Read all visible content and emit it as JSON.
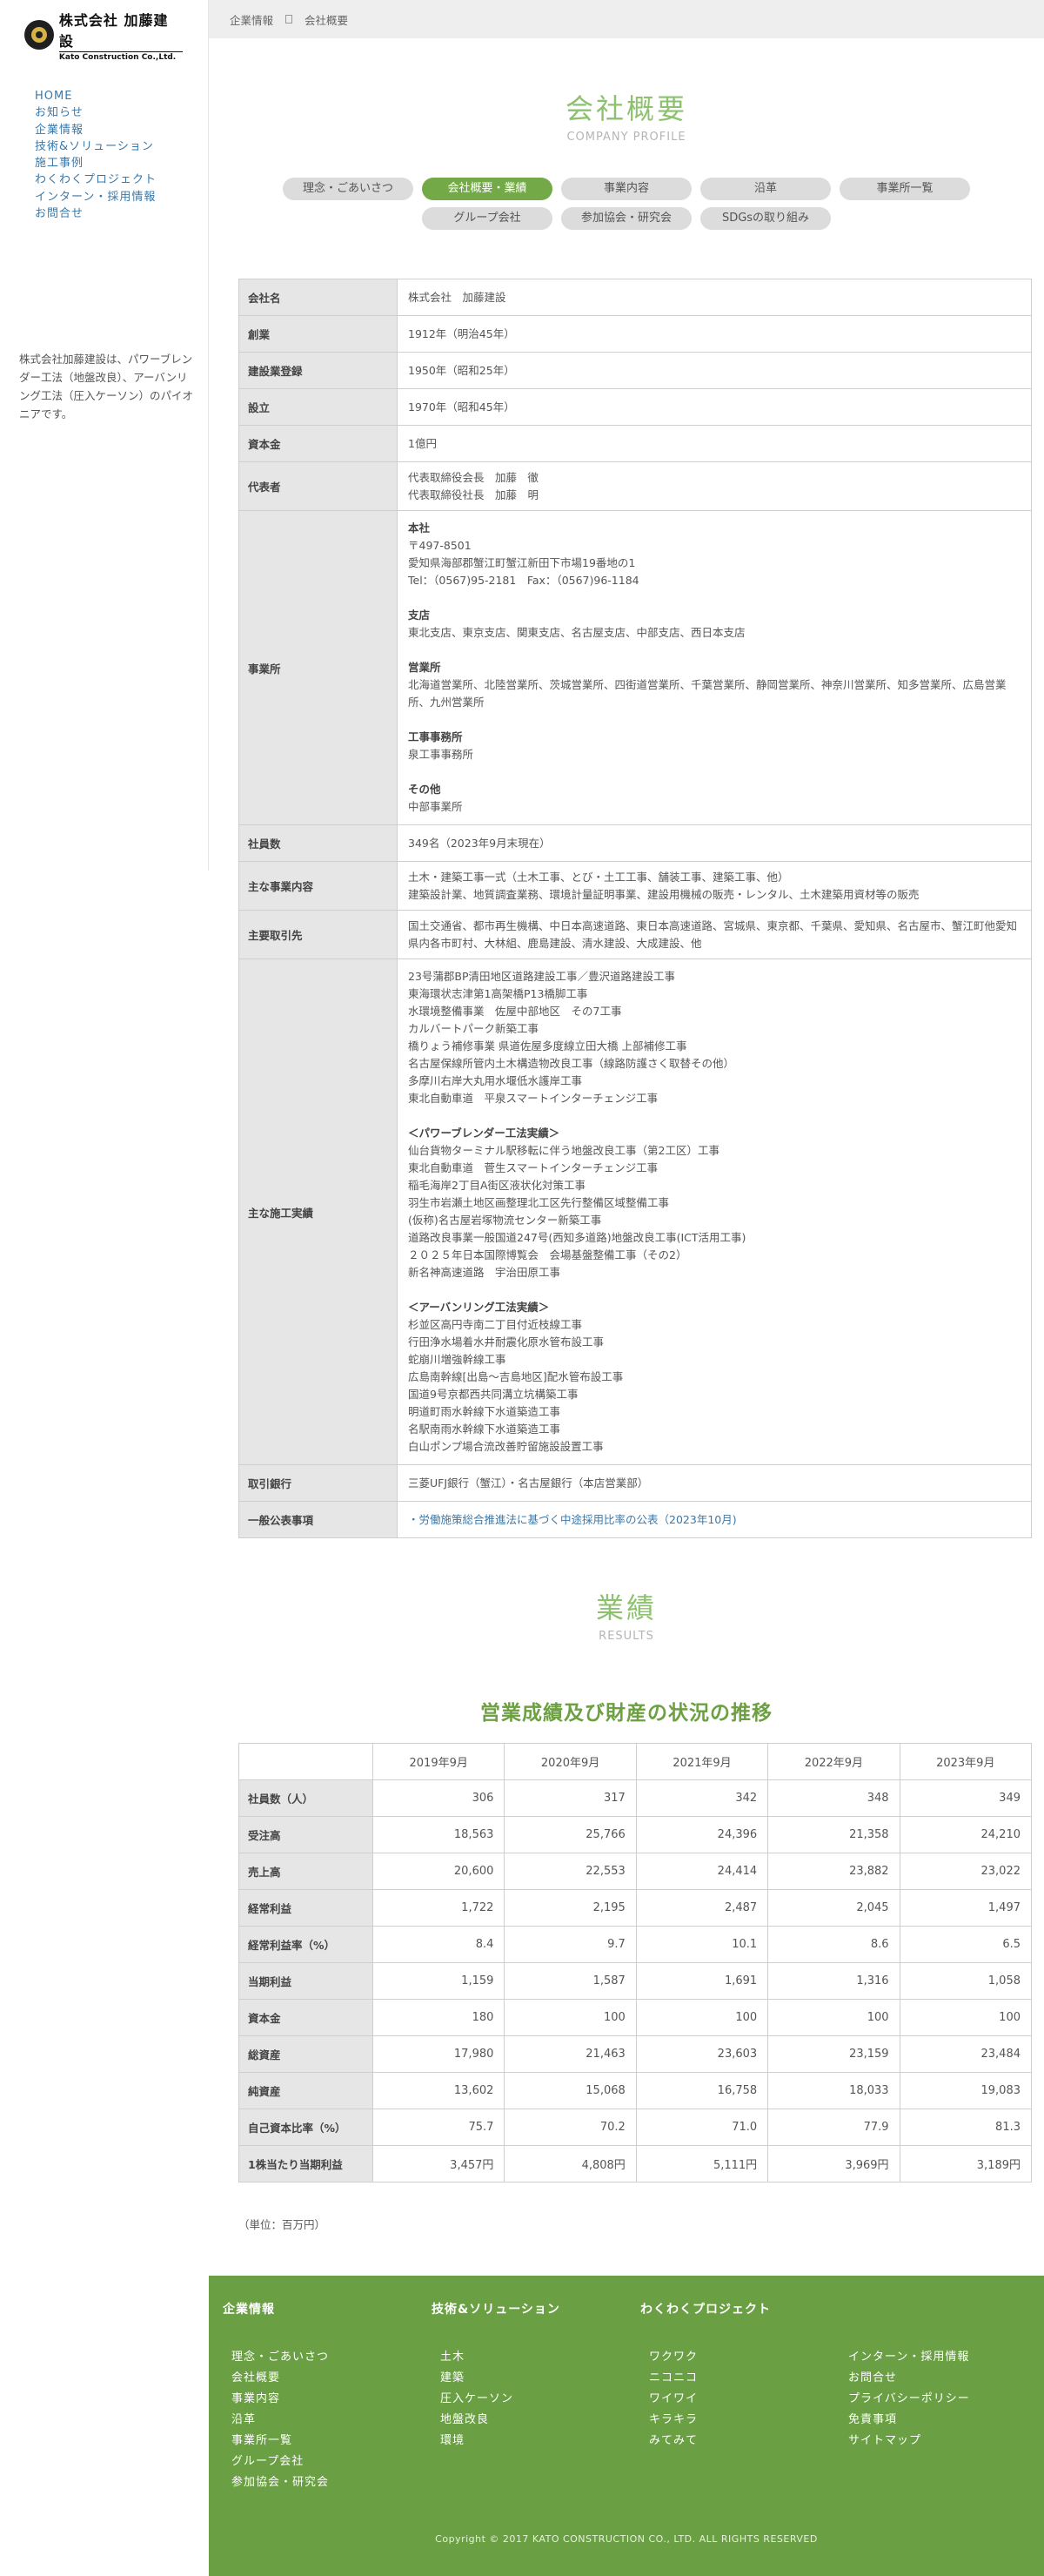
{
  "logo": {
    "name_jp": "株式会社 加藤建設",
    "name_en": "Kato Construction Co.,Ltd."
  },
  "side_nav": [
    "HOME",
    "お知らせ",
    "企業情報",
    "技術&ソリューション",
    "施工事例",
    "わくわくプロジェクト",
    "インターン・採用情報",
    "お問合せ"
  ],
  "side_description": "株式会社加藤建設は、パワーブレンダー工法（地盤改良）、アーバンリング工法（圧入ケーソン）のパイオニアです。",
  "breadcrumb": [
    "企業情報",
    "会社概要"
  ],
  "profile_heading": {
    "jp": "会社概要",
    "en": "COMPANY PROFILE"
  },
  "tabs": [
    "理念・ごあいさつ",
    "会社概要・業績",
    "事業内容",
    "沿革",
    "事業所一覧",
    "グループ会社",
    "参加協会・研究会",
    "SDGsの取り組み"
  ],
  "active_tab": "会社概要・業績",
  "profile": {
    "company_name": {
      "label": "会社名",
      "value": "株式会社　加藤建設"
    },
    "founded": {
      "label": "創業",
      "value": "1912年（明治45年）"
    },
    "registration": {
      "label": "建設業登録",
      "value": "1950年（昭和25年）"
    },
    "established": {
      "label": "設立",
      "value": "1970年（昭和45年）"
    },
    "capital": {
      "label": "資本金",
      "value": "1億円"
    },
    "representative": {
      "label": "代表者",
      "lines": [
        "代表取締役会長　加藤　徹",
        "代表取締役社長　加藤　明"
      ]
    },
    "offices": {
      "label": "事業所",
      "head_title": "本社",
      "head_lines": [
        "〒497-8501",
        "愛知県海部郡蟹江町蟹江新田下市場19番地の1",
        "Tel：（0567)95-2181　Fax：（0567)96-1184"
      ],
      "branch_title": "支店",
      "branch_line": "東北支店、東京支店、関東支店、名古屋支店、中部支店、西日本支店",
      "sales_title": "営業所",
      "sales_line": "北海道営業所、北陸営業所、茨城営業所、四街道営業所、千葉営業所、静岡営業所、神奈川営業所、知多営業所、広島営業所、九州営業所",
      "works_title": "工事事務所",
      "works_line": "泉工事事務所",
      "other_title": "その他",
      "other_line": "中部事業所"
    },
    "employees": {
      "label": "社員数",
      "value": "349名（2023年9月末現在）"
    },
    "business": {
      "label": "主な事業内容",
      "lines": [
        "土木・建築工事一式（土木工事、とび・土工工事、舗装工事、建築工事、他）",
        "建築設計業、地質調査業務、環境計量証明事業、建設用機械の販売・レンタル、土木建築用資材等の販売"
      ]
    },
    "clients": {
      "label": "主要取引先",
      "value": "国土交通省、都市再生機構、中日本高速道路、東日本高速道路、宮城県、東京都、千葉県、愛知県、名古屋市、蟹江町他愛知県内各市町村、大林組、鹿島建設、清水建設、大成建設、他"
    },
    "works": {
      "label": "主な施工実績",
      "group1": [
        "23号蒲郡BP清田地区道路建設工事／豊沢道路建設工事",
        "東海環状志津第1高架橋P13橋脚工事",
        "水環境整備事業　佐屋中部地区　その7工事",
        "カルバートパーク新築工事",
        "橋りょう補修事業 県道佐屋多度線立田大橋 上部補修工事",
        "名古屋保線所管内土木構造物改良工事（線路防護さく取替その他）",
        "多摩川右岸大丸用水堰低水護岸工事",
        "東北自動車道　平泉スマートインターチェンジ工事"
      ],
      "pb_title": "＜パワーブレンダー工法実績＞",
      "group2": [
        "仙台貨物ターミナル駅移転に伴う地盤改良工事（第2工区）工事",
        "東北自動車道　菅生スマートインターチェンジ工事",
        "稲毛海岸2丁目A街区液状化対策工事",
        "羽生市岩瀬土地区画整理北工区先行整備区域整備工事",
        "(仮称)名古屋岩塚物流センター新築工事",
        "道路改良事業一般国道247号(西知多道路)地盤改良工事(ICT活用工事)",
        "２０２５年日本国際博覧会　会場基盤整備工事（その2）",
        "新名神高速道路　宇治田原工事"
      ],
      "ur_title": "＜アーバンリング工法実績＞",
      "group3": [
        "杉並区高円寺南二丁目付近枝線工事",
        "行田浄水場着水井耐震化原水管布設工事",
        "蛇崩川増強幹線工事",
        "広島南幹線[出島〜吉島地区]配水管布設工事",
        "国道9号京都西共同溝立坑構築工事",
        "明道町雨水幹線下水道築造工事",
        "名駅南雨水幹線下水道築造工事",
        "白山ポンプ場合流改善貯留施設設置工事"
      ]
    },
    "bank": {
      "label": "取引銀行",
      "value": "三菱UFJ銀行（蟹江）・名古屋銀行（本店営業部）"
    },
    "public_notice": {
      "label": "一般公表事項",
      "value": "・労働施策総合推進法に基づく中途採用比率の公表（2023年10月)"
    }
  },
  "results_heading": {
    "jp": "業績",
    "en": "RESULTS"
  },
  "results_subtitle": "営業成績及び財産の状況の推移",
  "results_table": {
    "years": [
      "2019年9月",
      "2020年9月",
      "2021年9月",
      "2022年9月",
      "2023年9月"
    ],
    "rows": [
      {
        "label": "社員数（人）",
        "values": [
          "306",
          "317",
          "342",
          "348",
          "349"
        ]
      },
      {
        "label": "受注高",
        "values": [
          "18,563",
          "25,766",
          "24,396",
          "21,358",
          "24,210"
        ]
      },
      {
        "label": "売上高",
        "values": [
          "20,600",
          "22,553",
          "24,414",
          "23,882",
          "23,022"
        ]
      },
      {
        "label": "経常利益",
        "values": [
          "1,722",
          "2,195",
          "2,487",
          "2,045",
          "1,497"
        ]
      },
      {
        "label": "経常利益率（%）",
        "values": [
          "8.4",
          "9.7",
          "10.1",
          "8.6",
          "6.5"
        ]
      },
      {
        "label": "当期利益",
        "values": [
          "1,159",
          "1,587",
          "1,691",
          "1,316",
          "1,058"
        ]
      },
      {
        "label": "資本金",
        "values": [
          "180",
          "100",
          "100",
          "100",
          "100"
        ]
      },
      {
        "label": "総資産",
        "values": [
          "17,980",
          "21,463",
          "23,603",
          "23,159",
          "23,484"
        ]
      },
      {
        "label": "純資産",
        "values": [
          "13,602",
          "15,068",
          "16,758",
          "18,033",
          "19,083"
        ]
      },
      {
        "label": "自己資本比率（%）",
        "values": [
          "75.7",
          "70.2",
          "71.0",
          "77.9",
          "81.3"
        ]
      },
      {
        "label": "1株当たり当期利益",
        "values": [
          "3,457円",
          "4,808円",
          "5,111円",
          "3,969円",
          "3,189円"
        ]
      }
    ],
    "unit_note": "（単位：百万円）"
  },
  "footer": {
    "col1": {
      "title": "企業情報",
      "items": [
        "理念・ごあいさつ",
        "会社概要",
        "事業内容",
        "沿革",
        "事業所一覧",
        "グループ会社",
        "参加協会・研究会"
      ]
    },
    "col2": {
      "title": "技術&ソリューション",
      "items": [
        "土木",
        "建築",
        "圧入ケーソン",
        "地盤改良",
        "環境"
      ]
    },
    "col3": {
      "title": "わくわくプロジェクト",
      "items": [
        "ワクワク",
        "ニコニコ",
        "ワイワイ",
        "キラキラ",
        "みてみて"
      ]
    },
    "col4": {
      "items": [
        "インターン・採用情報",
        "お問合せ",
        "プライバシーポリシー",
        "免責事項",
        "サイトマップ"
      ]
    },
    "copyright": "Copyright © 2017 KATO CONSTRUCTION CO., LTD. ALL RIGHTS RESERVED"
  },
  "colors": {
    "accent_green": "#74a947",
    "footer_green": "#6aa043",
    "link_blue": "#3b78a8",
    "heading_green": "#8cc26d"
  }
}
